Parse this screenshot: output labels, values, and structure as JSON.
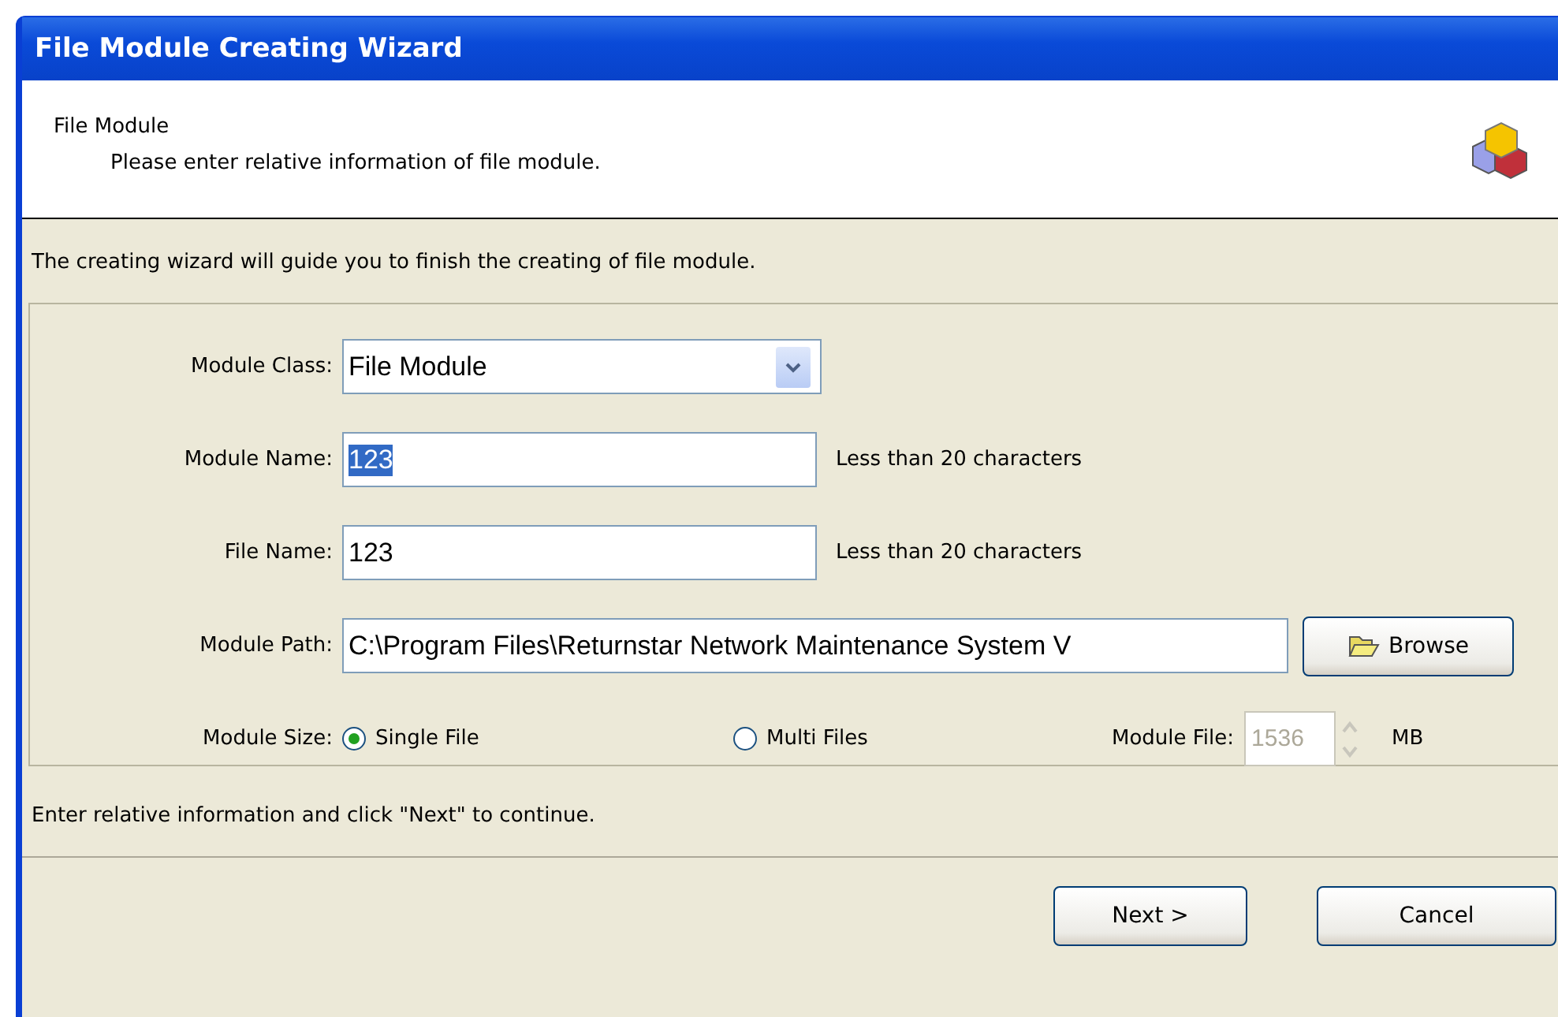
{
  "window": {
    "title": "File Module Creating Wizard"
  },
  "header": {
    "title": "File Module",
    "subtitle": "Please enter relative information of file module."
  },
  "intro": "The creating wizard will guide you to finish the creating of file module.",
  "form": {
    "module_class": {
      "label": "Module Class:",
      "value": "File Module"
    },
    "module_name": {
      "label": "Module Name:",
      "value": "123",
      "selected": true,
      "hint": "Less than 20 characters"
    },
    "file_name": {
      "label": "File Name:",
      "value": "123",
      "selected": false,
      "hint": "Less than 20 characters"
    },
    "module_path": {
      "label": "Module Path:",
      "value": "C:\\Program Files\\Returnstar Network Maintenance System V",
      "button": "Browse"
    },
    "module_size": {
      "label": "Module Size:",
      "options": [
        {
          "label": "Single File",
          "selected": true
        },
        {
          "label": "Multi Files",
          "selected": false
        }
      ]
    },
    "module_file": {
      "label": "Module File:",
      "value": "1536",
      "disabled": true,
      "unit": "MB"
    }
  },
  "footer_note": "Enter relative information and click \"Next\" to continue.",
  "buttons": [
    "Next >",
    "Cancel"
  ]
}
